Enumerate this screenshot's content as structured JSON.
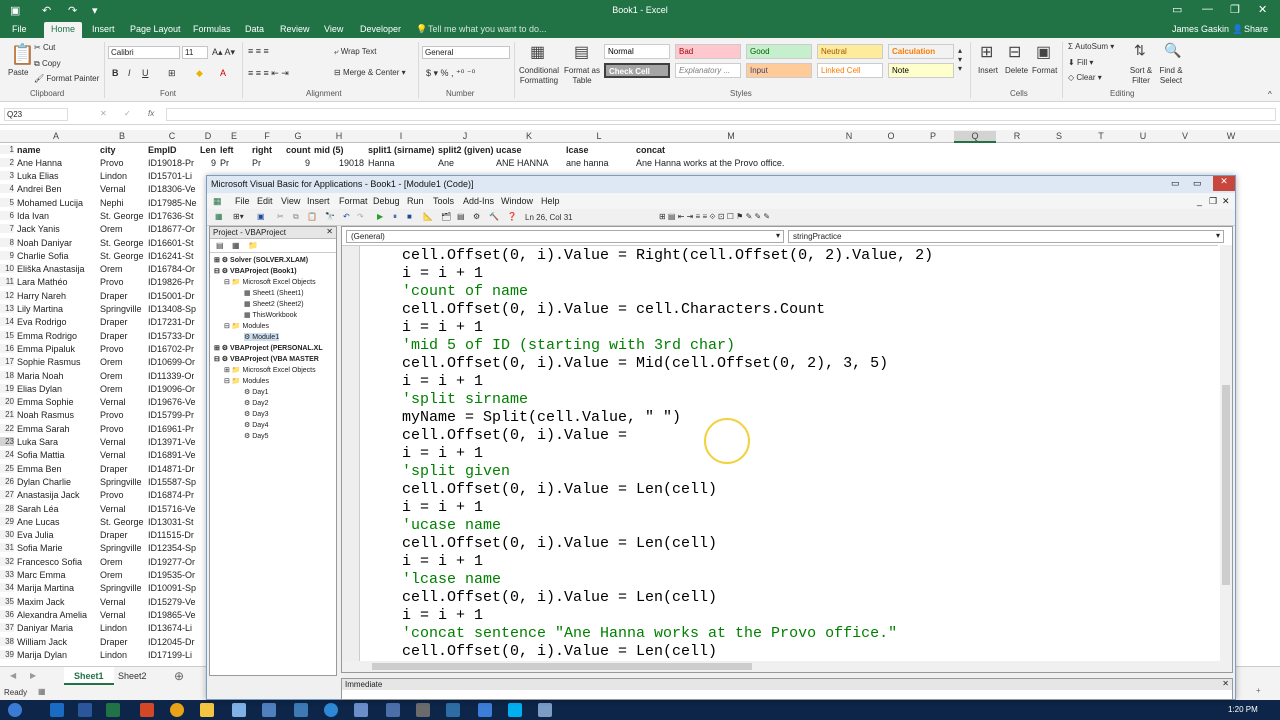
{
  "app": {
    "title": "Book1 - Excel",
    "user": "James Gaskin",
    "share": "Share"
  },
  "tabs": [
    "File",
    "Home",
    "Insert",
    "Page Layout",
    "Formulas",
    "Data",
    "Review",
    "View",
    "Developer"
  ],
  "tell_me": "Tell me what you want to do...",
  "ribbon": {
    "clipboard": {
      "paste": "Paste",
      "cut": "Cut",
      "copy": "Copy",
      "format_painter": "Format Painter",
      "group": "Clipboard"
    },
    "font": {
      "name": "Calibri",
      "size": "11",
      "group": "Font"
    },
    "alignment": {
      "wrap": "Wrap Text",
      "merge": "Merge & Center",
      "group": "Alignment"
    },
    "number": {
      "format": "General",
      "group": "Number"
    },
    "styles": {
      "cond": "Conditional Formatting",
      "format_table": "Format as Table",
      "group": "Styles",
      "items": [
        [
          "Normal",
          "#ffffff",
          "#000000"
        ],
        [
          "Bad",
          "#ffc7ce",
          "#9c0006"
        ],
        [
          "Good",
          "#c6efce",
          "#006100"
        ],
        [
          "Neutral",
          "#ffeb9c",
          "#9c5700"
        ],
        [
          "Calculation",
          "#f2f2f2",
          "#fa7d00"
        ],
        [
          "Check Cell",
          "#a5a5a5",
          "#ffffff"
        ],
        [
          "Explanatory ...",
          "#ffffff",
          "#7f7f7f"
        ],
        [
          "Input",
          "#ffcc99",
          "#3f3f76"
        ],
        [
          "Linked Cell",
          "#ffffff",
          "#fa7d00"
        ],
        [
          "Note",
          "#ffffcc",
          "#000000"
        ]
      ]
    },
    "cells": {
      "insert": "Insert",
      "delete": "Delete",
      "format": "Format",
      "group": "Cells"
    },
    "editing": {
      "autosum": "AutoSum",
      "fill": "Fill",
      "clear": "Clear",
      "sort": "Sort & Filter",
      "find": "Find & Select",
      "group": "Editing"
    }
  },
  "name_box": "Q23",
  "columns": [
    "A",
    "B",
    "C",
    "D",
    "E",
    "F",
    "G",
    "H",
    "I",
    "J",
    "K",
    "L",
    "M",
    "N",
    "O",
    "P",
    "Q",
    "R",
    "S",
    "T",
    "U",
    "V",
    "W"
  ],
  "header_row": [
    "name",
    "city",
    "EmpID",
    "Len",
    "left",
    "right",
    "count",
    "mid (5)",
    "split1 (sirname)",
    "split2 (given)",
    "ucase",
    "lcase",
    "concat"
  ],
  "row2": [
    "Ane Hanna",
    "Provo",
    "ID19018-Pr",
    "9",
    "Pr",
    "Pr",
    "9",
    "19018",
    "Hanna",
    "Ane",
    "ANE HANNA",
    "ane hanna",
    "Ane Hanna works at the Provo office."
  ],
  "rows": [
    [
      "3",
      "Luka Elias",
      "Lindon",
      "ID15701-Li"
    ],
    [
      "4",
      "Andrei Ben",
      "Vernal",
      "ID18306-Ve"
    ],
    [
      "5",
      "Mohamed Lucija",
      "Nephi",
      "ID17985-Ne"
    ],
    [
      "6",
      "Ida Ivan",
      "St. George",
      "ID17636-St"
    ],
    [
      "7",
      "Jack Yanis",
      "Orem",
      "ID18677-Or"
    ],
    [
      "8",
      "Noah Daniyar",
      "St. George",
      "ID16601-St"
    ],
    [
      "9",
      "Charlie Sofia",
      "St. George",
      "ID16241-St"
    ],
    [
      "10",
      "Eliška Anastasija",
      "Orem",
      "ID16784-Or"
    ],
    [
      "11",
      "Lara Mathéo",
      "Provo",
      "ID19826-Pr"
    ],
    [
      "12",
      "Harry Nareh",
      "Draper",
      "ID15001-Dr"
    ],
    [
      "13",
      "Lily Martina",
      "Springville",
      "ID13408-Sp"
    ],
    [
      "14",
      "Eva Rodrigo",
      "Draper",
      "ID17231-Dr"
    ],
    [
      "15",
      "Emma Rodrigo",
      "Draper",
      "ID15733-Dr"
    ],
    [
      "16",
      "Emma Pipaluk",
      "Provo",
      "ID16702-Pr"
    ],
    [
      "17",
      "Sophie Rasmus",
      "Orem",
      "ID10699-Or"
    ],
    [
      "18",
      "Maria Noah",
      "Orem",
      "ID11339-Or"
    ],
    [
      "19",
      "Elias Dylan",
      "Orem",
      "ID19096-Or"
    ],
    [
      "20",
      "Emma Sophie",
      "Vernal",
      "ID19676-Ve"
    ],
    [
      "21",
      "Noah Rasmus",
      "Provo",
      "ID15799-Pr"
    ],
    [
      "22",
      "Emma Sarah",
      "Provo",
      "ID16961-Pr"
    ],
    [
      "23",
      "Luka Sara",
      "Vernal",
      "ID13971-Ve"
    ],
    [
      "24",
      "Sofia Mattia",
      "Vernal",
      "ID16891-Ve"
    ],
    [
      "25",
      "Emma Ben",
      "Draper",
      "ID14871-Dr"
    ],
    [
      "26",
      "Dylan Charlie",
      "Springville",
      "ID15587-Sp"
    ],
    [
      "27",
      "Anastasija Jack",
      "Provo",
      "ID16874-Pr"
    ],
    [
      "28",
      "Sarah Léa",
      "Vernal",
      "ID15716-Ve"
    ],
    [
      "29",
      "Ane Lucas",
      "St. George",
      "ID13031-St"
    ],
    [
      "30",
      "Eva Julia",
      "Draper",
      "ID11515-Dr"
    ],
    [
      "31",
      "Sofia Marie",
      "Springville",
      "ID12354-Sp"
    ],
    [
      "32",
      "Francesco Sofia",
      "Orem",
      "ID19277-Or"
    ],
    [
      "33",
      "Marc Emma",
      "Orem",
      "ID19535-Or"
    ],
    [
      "34",
      "Marija Martina",
      "Springville",
      "ID10091-Sp"
    ],
    [
      "35",
      "Maxim Jack",
      "Vernal",
      "ID15279-Ve"
    ],
    [
      "36",
      "Alexandra Amelia",
      "Vernal",
      "ID19865-Ve"
    ],
    [
      "37",
      "Daniyar Maria",
      "Lindon",
      "ID13674-Li"
    ],
    [
      "38",
      "William Jack",
      "Draper",
      "ID12045-Dr"
    ],
    [
      "39",
      "Marija Dylan",
      "Lindon",
      "ID17199-Li"
    ]
  ],
  "sheets": [
    "Sheet1",
    "Sheet2"
  ],
  "status": "Ready",
  "time": "1:20 PM",
  "vbe": {
    "title": "Microsoft Visual Basic for Applications - Book1 - [Module1 (Code)]",
    "menu": [
      "File",
      "Edit",
      "View",
      "Insert",
      "Format",
      "Debug",
      "Run",
      "Tools",
      "Add-Ins",
      "Window",
      "Help"
    ],
    "cursor_pos": "Ln 26, Col 31",
    "project_title": "Project - VBAProject",
    "tree": [
      "Solver (SOLVER.XLAM)",
      "VBAProject (Book1)",
      "Microsoft Excel Objects",
      "Sheet1 (Sheet1)",
      "Sheet2 (Sheet2)",
      "ThisWorkbook",
      "Modules",
      "Module1",
      "VBAProject (PERSONAL.XL",
      "VBAProject (VBA MASTER",
      "Microsoft Excel Objects",
      "Modules",
      "Day1",
      "Day2",
      "Day3",
      "Day4",
      "Day5"
    ],
    "combo_left": "(General)",
    "combo_right": "stringPractice",
    "code": [
      [
        "cell.Offset(0, i).Value = Right(cell.Offset(0, 2).Value, 2)",
        false
      ],
      [
        "i = i + 1",
        false
      ],
      [
        "'count of name",
        true
      ],
      [
        "cell.Offset(0, i).Value = cell.Characters.Count",
        false
      ],
      [
        "i = i + 1",
        false
      ],
      [
        "'mid 5 of ID (starting with 3rd char)",
        true
      ],
      [
        "cell.Offset(0, i).Value = Mid(cell.Offset(0, 2), 3, 5)",
        false
      ],
      [
        "i = i + 1",
        false
      ],
      [
        "'split sirname",
        true
      ],
      [
        "myName = Split(cell.Value, \" \")",
        false
      ],
      [
        "cell.Offset(0, i).Value =",
        false
      ],
      [
        "i = i + 1",
        false
      ],
      [
        "'split given",
        true
      ],
      [
        "cell.Offset(0, i).Value = Len(cell)",
        false
      ],
      [
        "i = i + 1",
        false
      ],
      [
        "'ucase name",
        true
      ],
      [
        "cell.Offset(0, i).Value = Len(cell)",
        false
      ],
      [
        "i = i + 1",
        false
      ],
      [
        "'lcase name",
        true
      ],
      [
        "cell.Offset(0, i).Value = Len(cell)",
        false
      ],
      [
        "i = i + 1",
        false
      ],
      [
        "'concat sentence \"Ane Hanna works at the Provo office.\"",
        true
      ],
      [
        "cell.Offset(0, i).Value = Len(cell)",
        false
      ]
    ],
    "immediate": "Immediate"
  }
}
